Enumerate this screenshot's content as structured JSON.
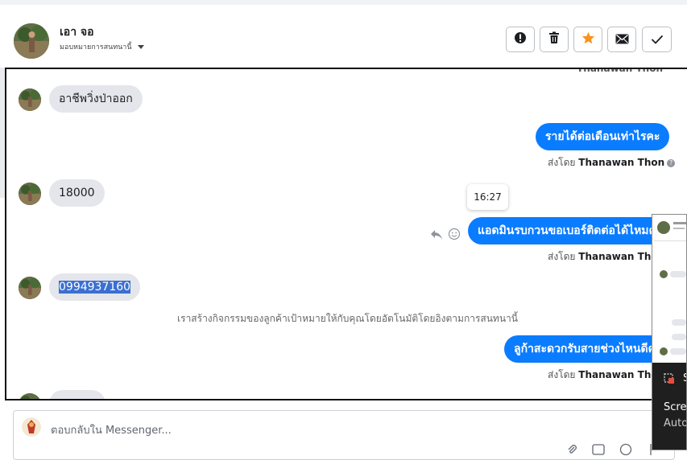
{
  "header": {
    "contact_name": "เอา จอ",
    "assign_label": "มอบหมายการสนทนานี้",
    "actions": [
      {
        "name": "report",
        "icon": "exclamation-icon"
      },
      {
        "name": "delete",
        "icon": "trash-icon"
      },
      {
        "name": "star",
        "icon": "star-icon",
        "color": "#f7931e"
      },
      {
        "name": "mark-unread",
        "icon": "envelope-icon"
      },
      {
        "name": "done",
        "icon": "check-icon"
      }
    ]
  },
  "conversation": {
    "sentby_top_name": "Thanawan Thon",
    "messages": [
      {
        "side": "in",
        "text": "อาชีพวิ่งป่าออก"
      },
      {
        "side": "out",
        "text": "รายได้ต่อเดือนเท่าไรคะ",
        "sentby_prefix": "ส่งโดย",
        "sentby_name": "Thanawan Thon"
      },
      {
        "side": "in",
        "text": "18000"
      },
      {
        "side": "out",
        "text": "แอดมินรบกวนขอเบอร์ติดต่อได้ไหมคะ",
        "sentby_prefix": "ส่งโดย",
        "sentby_name": "Thanawan Thon"
      },
      {
        "side": "in",
        "text": "0994937160"
      },
      {
        "side": "out",
        "text": "ลูก้าสะดวกรับสายช่วงไหนดีคะ",
        "sentby_prefix": "ส่งโดย",
        "sentby_name": "Thanawan Thon"
      }
    ],
    "timestamp_tooltip": "16:27",
    "system_note": "เราสร้างกิจกรรมของลูกค้าเป้าหมายให้กับคุณโดยอัตโนมัติโดยอิงตามการสนทนานี้"
  },
  "reply": {
    "placeholder": "ตอบกลับใน Messenger..."
  },
  "thumbnail": {
    "line1": "Scre",
    "line2": "Auto"
  },
  "colors": {
    "outgoing_bubble": "#0a7cff",
    "incoming_bubble": "#e4e6eb",
    "star": "#f7931e"
  }
}
